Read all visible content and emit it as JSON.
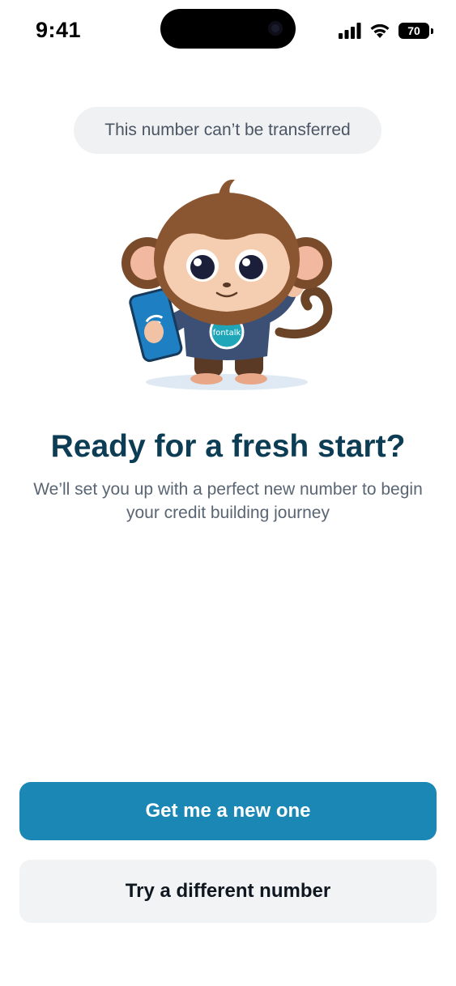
{
  "status_bar": {
    "time": "9:41",
    "battery_level": "70",
    "icons": [
      "signal-icon",
      "wifi-icon",
      "battery-icon"
    ]
  },
  "notice": {
    "pill_text": "This number can’t be transferred"
  },
  "illustration": {
    "name": "monkey-mascot-holding-phone",
    "badge_text": "fontalk"
  },
  "content": {
    "title": "Ready for a fresh start?",
    "subtitle": "We’ll set you up with a perfect new number to begin your credit building journey"
  },
  "actions": {
    "primary_label": "Get me a new one",
    "secondary_label": "Try a different number"
  },
  "colors": {
    "primary": "#1a87b5",
    "title": "#0c3d55",
    "pill_bg": "#f0f1f3",
    "secondary_bg": "#f2f3f5"
  }
}
